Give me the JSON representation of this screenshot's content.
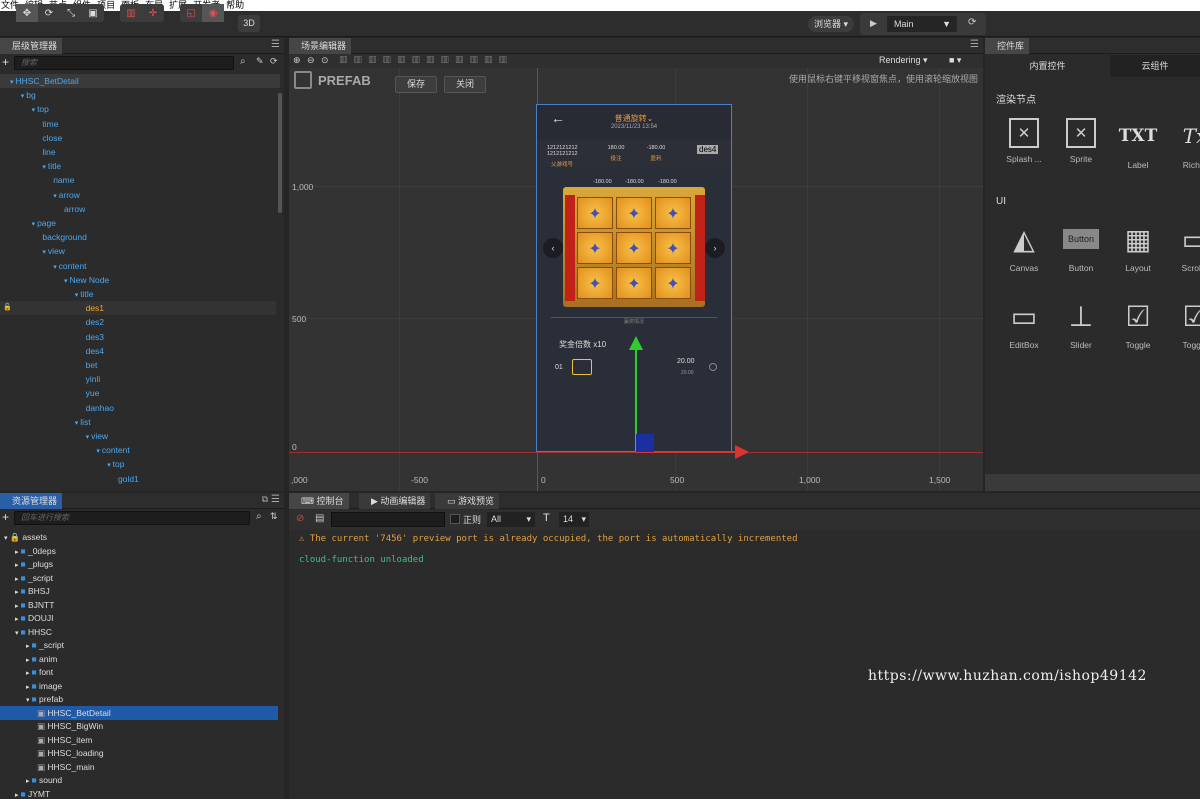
{
  "menu": [
    "文件",
    "编辑",
    "节点",
    "组件",
    "项目",
    "面板",
    "布局",
    "扩展",
    "开发者",
    "帮助"
  ],
  "toolbar": {
    "btn_3d": "3D",
    "browser": "浏览器 ▾",
    "scene": "Main",
    "play": "▶",
    "refresh": "⟳"
  },
  "hierarchy": {
    "title": "层级管理器",
    "search_placeholder": "搜索",
    "items": [
      {
        "label": "HHSC_BetDetail",
        "indent": 0,
        "type": "root"
      },
      {
        "label": "bg",
        "indent": 1,
        "type": "node"
      },
      {
        "label": "top",
        "indent": 2,
        "type": "node"
      },
      {
        "label": "time",
        "indent": 3,
        "type": "leaf"
      },
      {
        "label": "close",
        "indent": 3,
        "type": "leaf"
      },
      {
        "label": "line",
        "indent": 3,
        "type": "leaf"
      },
      {
        "label": "title",
        "indent": 3,
        "type": "node"
      },
      {
        "label": "name",
        "indent": 4,
        "type": "leaf"
      },
      {
        "label": "arrow",
        "indent": 4,
        "type": "node"
      },
      {
        "label": "arrow",
        "indent": 5,
        "type": "leaf"
      },
      {
        "label": "page",
        "indent": 2,
        "type": "node"
      },
      {
        "label": "background",
        "indent": 3,
        "type": "leaf"
      },
      {
        "label": "view",
        "indent": 3,
        "type": "node"
      },
      {
        "label": "content",
        "indent": 4,
        "type": "node"
      },
      {
        "label": "New Node",
        "indent": 5,
        "type": "node"
      },
      {
        "label": "title",
        "indent": 6,
        "type": "node"
      },
      {
        "label": "des1",
        "indent": 7,
        "type": "highlight"
      },
      {
        "label": "des2",
        "indent": 7,
        "type": "leaf"
      },
      {
        "label": "des3",
        "indent": 7,
        "type": "leaf"
      },
      {
        "label": "des4",
        "indent": 7,
        "type": "leaf"
      },
      {
        "label": "bet",
        "indent": 7,
        "type": "leaf"
      },
      {
        "label": "yinli",
        "indent": 7,
        "type": "leaf"
      },
      {
        "label": "yue",
        "indent": 7,
        "type": "leaf"
      },
      {
        "label": "danhao",
        "indent": 7,
        "type": "leaf"
      },
      {
        "label": "list",
        "indent": 6,
        "type": "node"
      },
      {
        "label": "view",
        "indent": 7,
        "type": "node"
      },
      {
        "label": "content",
        "indent": 8,
        "type": "node"
      },
      {
        "label": "top",
        "indent": 9,
        "type": "node"
      },
      {
        "label": "gold1",
        "indent": 10,
        "type": "leaf"
      }
    ]
  },
  "assets": {
    "title": "资源管理器",
    "search_placeholder": "回车进行搜索",
    "items": [
      {
        "label": "assets",
        "indent": 0,
        "kind": "root"
      },
      {
        "label": "_0deps",
        "indent": 1,
        "kind": "folder"
      },
      {
        "label": "_plugs",
        "indent": 1,
        "kind": "folder"
      },
      {
        "label": "_script",
        "indent": 1,
        "kind": "folder"
      },
      {
        "label": "BHSJ",
        "indent": 1,
        "kind": "folder"
      },
      {
        "label": "BJNTT",
        "indent": 1,
        "kind": "folder"
      },
      {
        "label": "DOUJI",
        "indent": 1,
        "kind": "folder"
      },
      {
        "label": "HHSC",
        "indent": 1,
        "kind": "folder-open"
      },
      {
        "label": "_script",
        "indent": 2,
        "kind": "folder"
      },
      {
        "label": "anim",
        "indent": 2,
        "kind": "folder"
      },
      {
        "label": "font",
        "indent": 2,
        "kind": "folder"
      },
      {
        "label": "image",
        "indent": 2,
        "kind": "folder"
      },
      {
        "label": "prefab",
        "indent": 2,
        "kind": "folder-open"
      },
      {
        "label": "HHSC_BetDetail",
        "indent": 3,
        "kind": "prefab",
        "selected": true
      },
      {
        "label": "HHSC_BigWin",
        "indent": 3,
        "kind": "prefab"
      },
      {
        "label": "HHSC_item",
        "indent": 3,
        "kind": "prefab"
      },
      {
        "label": "HHSC_loading",
        "indent": 3,
        "kind": "prefab"
      },
      {
        "label": "HHSC_main",
        "indent": 3,
        "kind": "prefab"
      },
      {
        "label": "sound",
        "indent": 2,
        "kind": "folder"
      },
      {
        "label": "JYMT",
        "indent": 1,
        "kind": "folder"
      }
    ]
  },
  "scene": {
    "title": "场景编辑器",
    "rendering": "Rendering",
    "prefab_label": "PREFAB",
    "save": "保存",
    "close": "关闭",
    "hint": "使用鼠标右键平移视窗焦点，使用滚轮缩放视图",
    "y_labels": [
      "1,000",
      "500",
      "0"
    ],
    "x_labels": [
      ",000",
      "-500",
      "0",
      "500",
      "1,000",
      "1,500"
    ]
  },
  "game": {
    "title": "普通旋转",
    "time": "2023/11/23 13:54",
    "info": [
      {
        "value": "1212121212\n1212121212",
        "label": "父游戏号"
      },
      {
        "value": "180.00",
        "label": "投注"
      },
      {
        "value": "-180.00",
        "label": "盈利"
      }
    ],
    "des4": "des4",
    "win_values": [
      "-180.00",
      "-180.00",
      "-180.00"
    ],
    "divider": "赢奖情况",
    "bonus": "奖金倍数 x10",
    "row_no": "01",
    "amount": "20.00",
    "amount_sub": "20.00"
  },
  "controls": {
    "tabs": [
      "内置控件",
      "云组件"
    ],
    "title": "控件库",
    "section_render": "渲染节点",
    "section_ui": "UI",
    "render_items": [
      "Splash ...",
      "Sprite",
      "Label",
      "Rich T"
    ],
    "ui_items_row1": [
      "Canvas",
      "Button",
      "Layout",
      "ScrollV"
    ],
    "ui_items_row2": [
      "EditBox",
      "Slider",
      "Toggle",
      "Toggle"
    ],
    "button_text": "Button",
    "txt_text": "TXT"
  },
  "console": {
    "tabs": [
      "控制台",
      "动画编辑器",
      "游戏预览"
    ],
    "regex_label": "正则",
    "filter": "All",
    "font_size": "14",
    "lines": [
      "The current '7456' preview port is already occupied, the port is automatically incremented",
      "cloud-function unloaded"
    ]
  },
  "watermark": "https://www.huzhan.com/ishop49142"
}
